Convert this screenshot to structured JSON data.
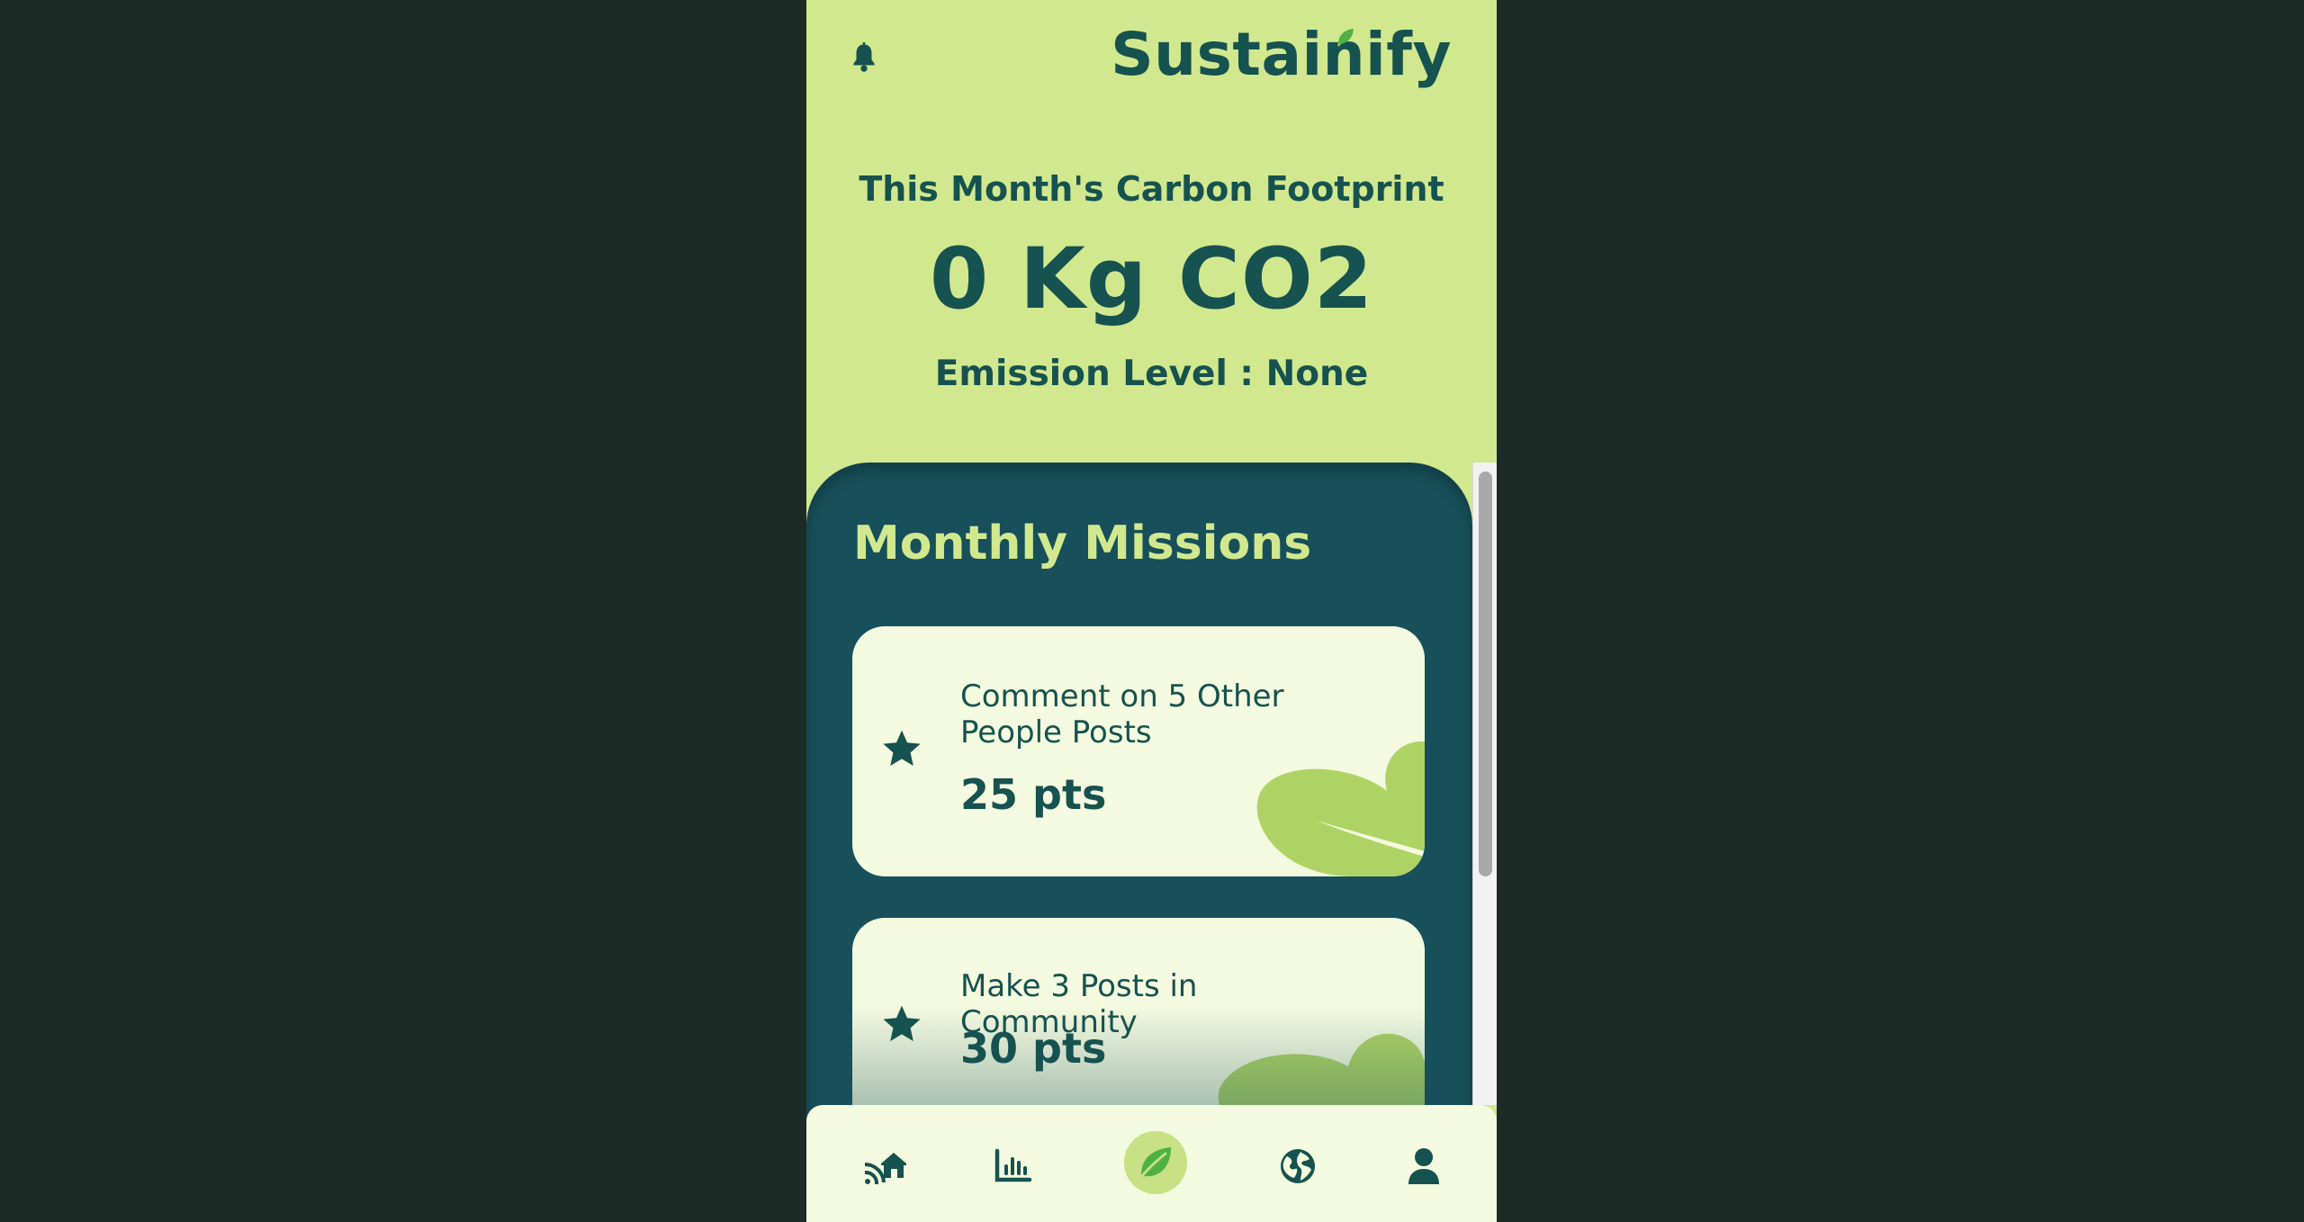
{
  "app": {
    "name": "Sustainify"
  },
  "header": {
    "icons": [
      "bell-icon"
    ]
  },
  "summary": {
    "title": "This Month's Carbon Footprint",
    "value": "0 Kg CO2",
    "level": "Emission Level : None"
  },
  "missions": {
    "title": "Monthly Missions",
    "items": [
      {
        "text": "Comment on 5 Other People Posts",
        "points": "25 pts",
        "icon": "star-icon"
      },
      {
        "text": "Make 3 Posts in Community",
        "points": "30 pts",
        "icon": "star-icon"
      }
    ]
  },
  "nav": {
    "items": [
      {
        "name": "home-feed",
        "icon": "home-feed-icon"
      },
      {
        "name": "statistics",
        "icon": "chart-icon"
      },
      {
        "name": "missions",
        "icon": "leaf-icon",
        "active": true
      },
      {
        "name": "community",
        "icon": "globe-icon"
      },
      {
        "name": "profile",
        "icon": "user-icon"
      }
    ]
  },
  "colors": {
    "page_background": "#1d2b27",
    "header_background": "#d1e88e",
    "panel_background": "#17505a",
    "card_background": "#f4fadf",
    "text_primary": "#16524f",
    "accent_green": "#d1e88e",
    "leaf_green": "#aed365"
  }
}
